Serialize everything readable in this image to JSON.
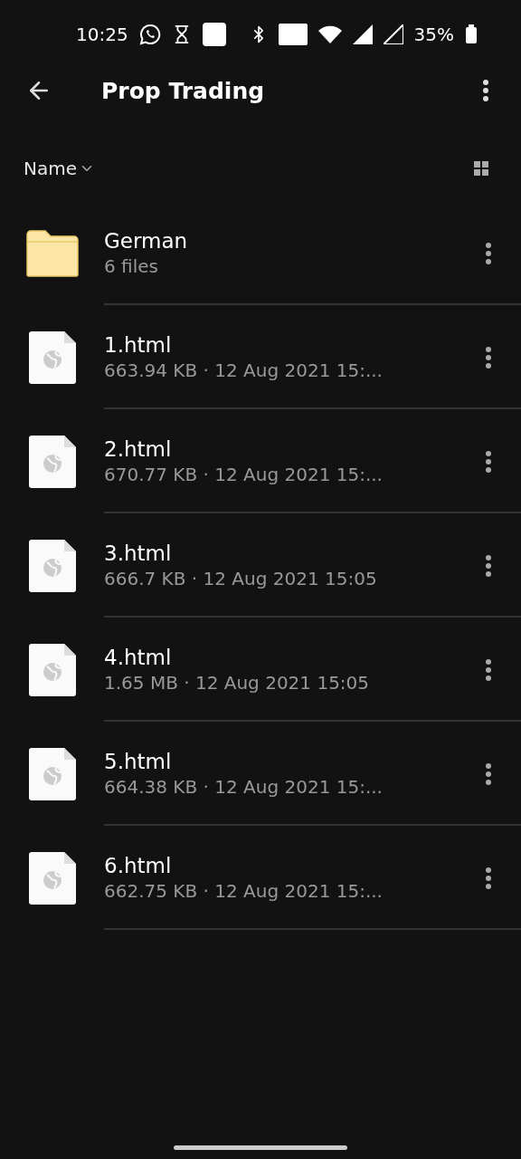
{
  "status_bar": {
    "time": "10:25",
    "battery": "35%"
  },
  "toolbar": {
    "title": "Prop Trading"
  },
  "sort": {
    "label": "Name"
  },
  "items": [
    {
      "kind": "folder",
      "name": "German",
      "details": "6 files"
    },
    {
      "kind": "file",
      "name": "1.html",
      "details": "663.94 KB · 12 Aug 2021 15:..."
    },
    {
      "kind": "file",
      "name": "2.html",
      "details": "670.77 KB · 12 Aug 2021 15:..."
    },
    {
      "kind": "file",
      "name": "3.html",
      "details": "666.7 KB · 12 Aug 2021 15:05"
    },
    {
      "kind": "file",
      "name": "4.html",
      "details": "1.65 MB · 12 Aug 2021 15:05"
    },
    {
      "kind": "file",
      "name": "5.html",
      "details": "664.38 KB · 12 Aug 2021 15:..."
    },
    {
      "kind": "file",
      "name": "6.html",
      "details": "662.75 KB · 12 Aug 2021 15:..."
    }
  ]
}
